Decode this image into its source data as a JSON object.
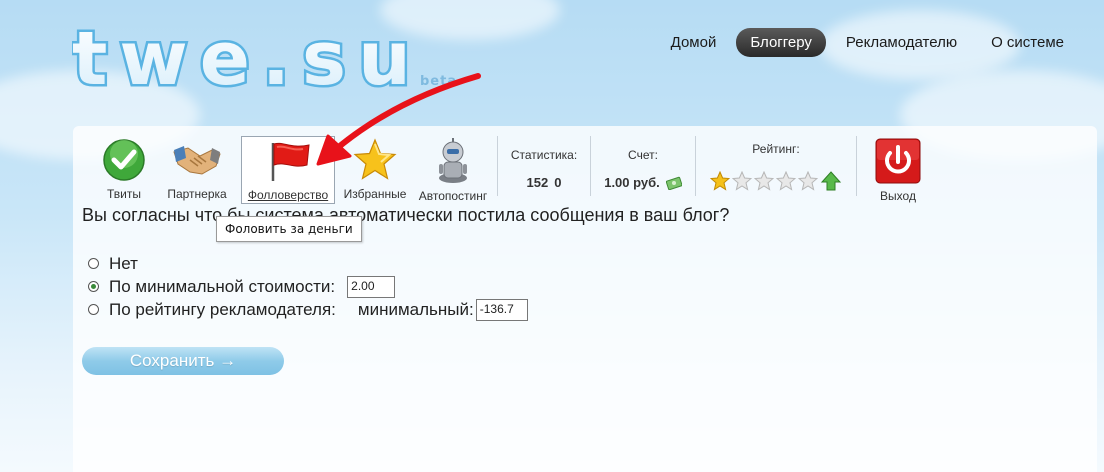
{
  "brand": {
    "logo_text": "twe.su",
    "badge": "beta"
  },
  "nav": {
    "items": [
      {
        "label": "Домой",
        "active": false
      },
      {
        "label": "Блоггеру",
        "active": true
      },
      {
        "label": "Рекламодателю",
        "active": false
      },
      {
        "label": "О системе",
        "active": false
      }
    ]
  },
  "toolbar": {
    "tweets": "Твиты",
    "partner": "Партнерка",
    "following": "Фолловерство",
    "favorites": "Избранные",
    "autopost": "Автопостинг",
    "stats_label": "Статистика:",
    "stats_a": "152",
    "stats_b": "0",
    "account_label": "Счет:",
    "account_value": "1.00 руб.",
    "rating_label": "Рейтинг:",
    "rating_stars": 1,
    "logout": "Выход"
  },
  "tooltip": "Фоловить за деньги",
  "form": {
    "question": "Вы согласны что бы система автоматически постила сообщения в ваш блог?",
    "opt_no": "Нет",
    "opt_min": "По минимальной стоимости:",
    "min_value": "2.00",
    "opt_rating": "По рейтингу рекламодателя:",
    "min_label": "минимальный:",
    "rating_value": "-136.7",
    "save": "Сохранить →"
  },
  "colors": {
    "accent": "#2b2b2b",
    "save": "#8fcbe9",
    "annotation": "#e8121a"
  }
}
